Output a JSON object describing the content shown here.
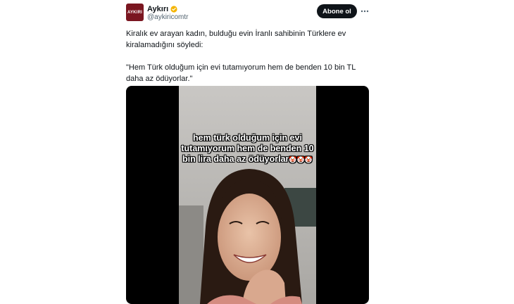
{
  "author": {
    "display_name": "Aykırı",
    "handle": "@aykiricomtr",
    "avatar_text": "AYKIRI",
    "verified_icon": "gold-verified-badge"
  },
  "actions": {
    "follow_label": "Abone ol",
    "more_icon": "ellipsis-horizontal"
  },
  "tweet": {
    "paragraph_1": "Kiralık ev arayan kadın, bulduğu evin İranlı sahibinin Türklere ev kiralamadığını söyledi:",
    "paragraph_2": "\"Hem Türk olduğum için evi tutamıyorum hem de benden 10 bin TL daha az ödüyorlar.\""
  },
  "video": {
    "caption_text": "hem türk olduğum için evi tutamıyorum hem de benden 10 bin lira daha az ödüyorlar",
    "caption_emoji": "🤡🤡🤡"
  },
  "colors": {
    "avatar_bg": "#7a1620",
    "follow_bg": "#0f1419",
    "handle": "#536471",
    "badge": "#f4b400"
  }
}
